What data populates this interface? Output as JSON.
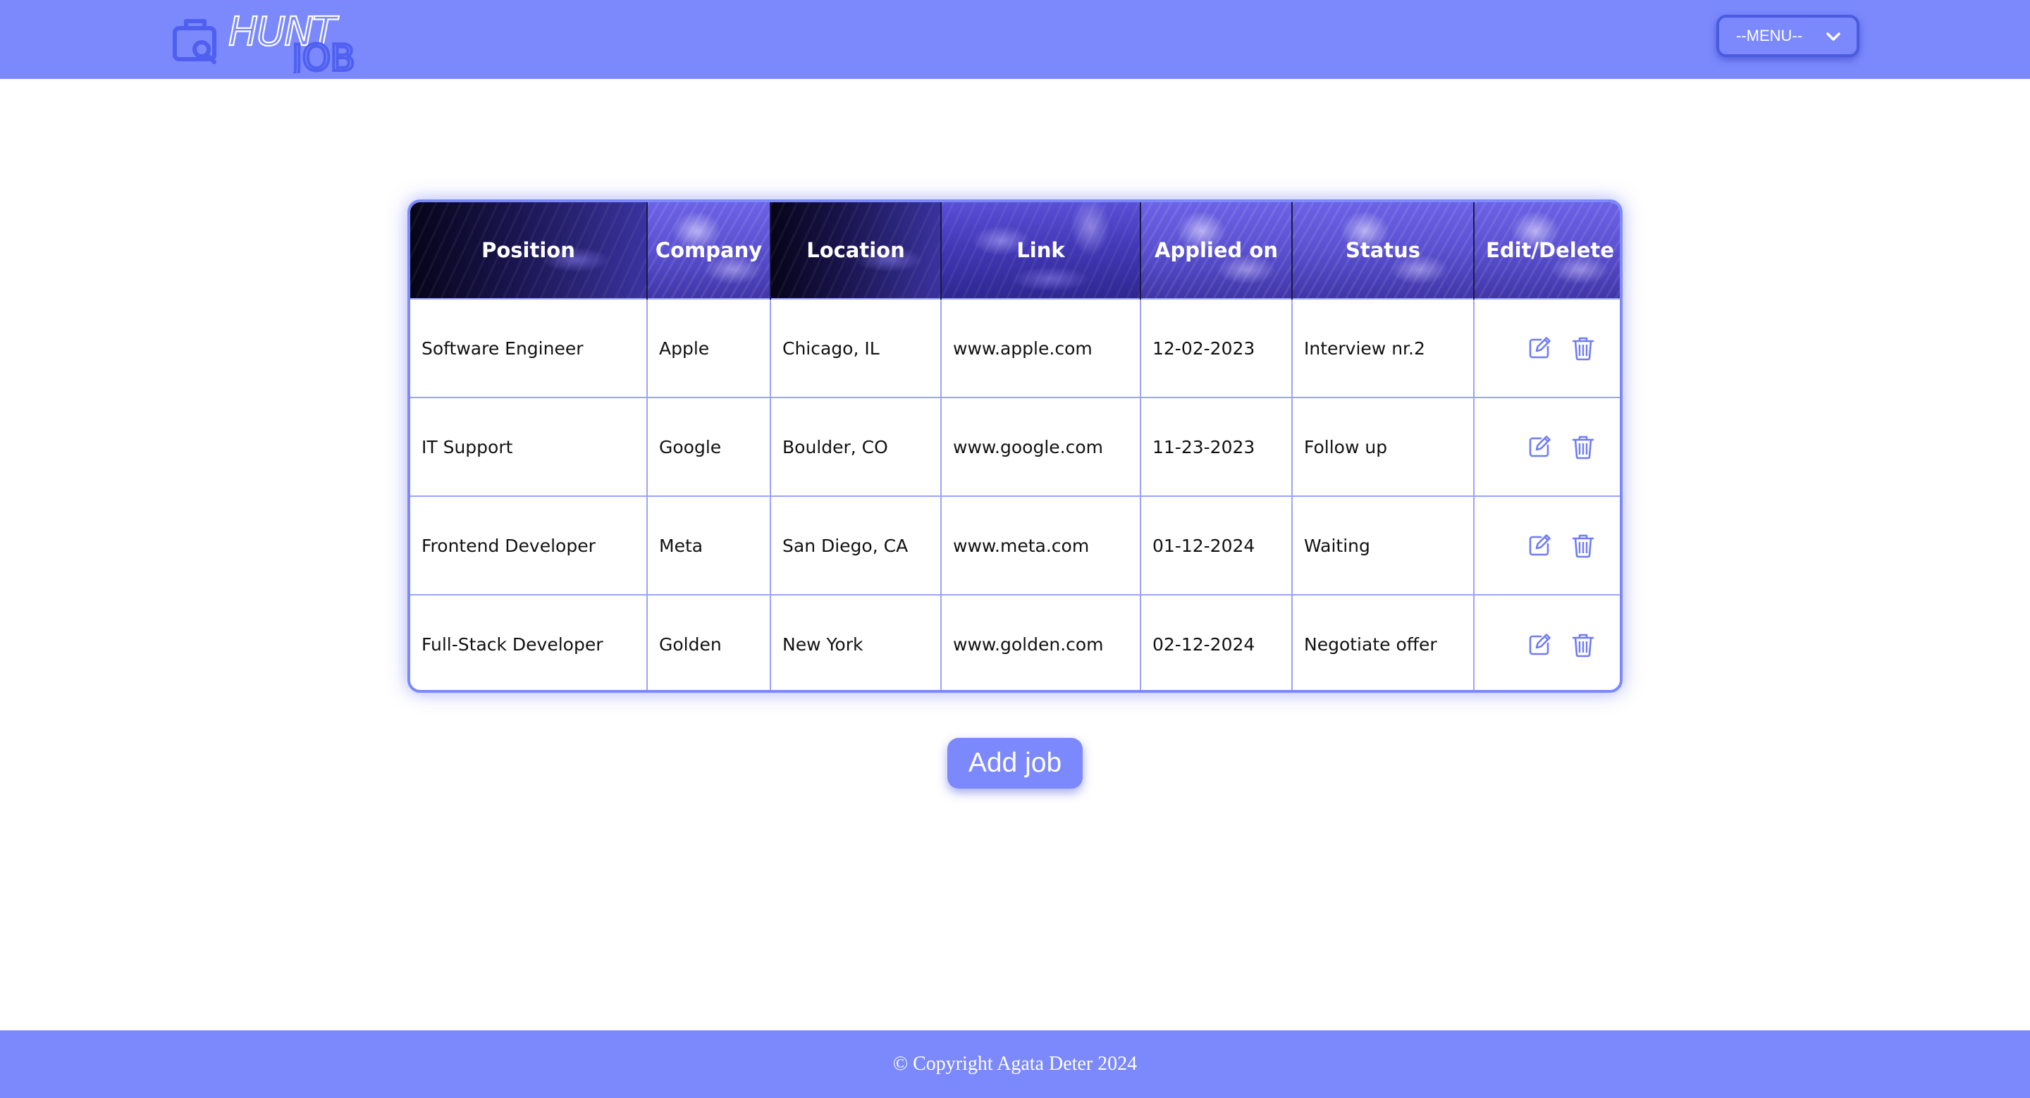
{
  "header": {
    "logo": {
      "word_top": "HUNT",
      "word_bottom": "JOB"
    },
    "menu": {
      "selected": "--MENU--"
    }
  },
  "table": {
    "columns": [
      "Position",
      "Company",
      "Location",
      "Link",
      "Applied on",
      "Status",
      "Edit/Delete"
    ],
    "rows": [
      {
        "position": "Software Engineer",
        "company": "Apple",
        "location": "Chicago, IL",
        "link": "www.apple.com",
        "applied_on": "12-02-2023",
        "status": "Interview nr.2"
      },
      {
        "position": "IT Support",
        "company": "Google",
        "location": "Boulder, CO",
        "link": "www.google.com",
        "applied_on": "11-23-2023",
        "status": "Follow up"
      },
      {
        "position": "Frontend Developer",
        "company": "Meta",
        "location": "San Diego, CA",
        "link": "www.meta.com",
        "applied_on": "01-12-2024",
        "status": "Waiting"
      },
      {
        "position": "Full-Stack Developer",
        "company": "Golden",
        "location": "New York",
        "link": "www.golden.com",
        "applied_on": "02-12-2024",
        "status": "Negotiate offer"
      }
    ],
    "row_actions": {
      "edit_icon": "edit-pencil-icon",
      "delete_icon": "trash-icon"
    }
  },
  "add_job_label": "Add job",
  "footer": {
    "copyright": "© Copyright Agata Deter 2024"
  },
  "colors": {
    "accent": "#7b89fd",
    "accent_dark": "#4a5be0",
    "icon": "#6f7cf5",
    "grid": "#9aa4fb"
  }
}
